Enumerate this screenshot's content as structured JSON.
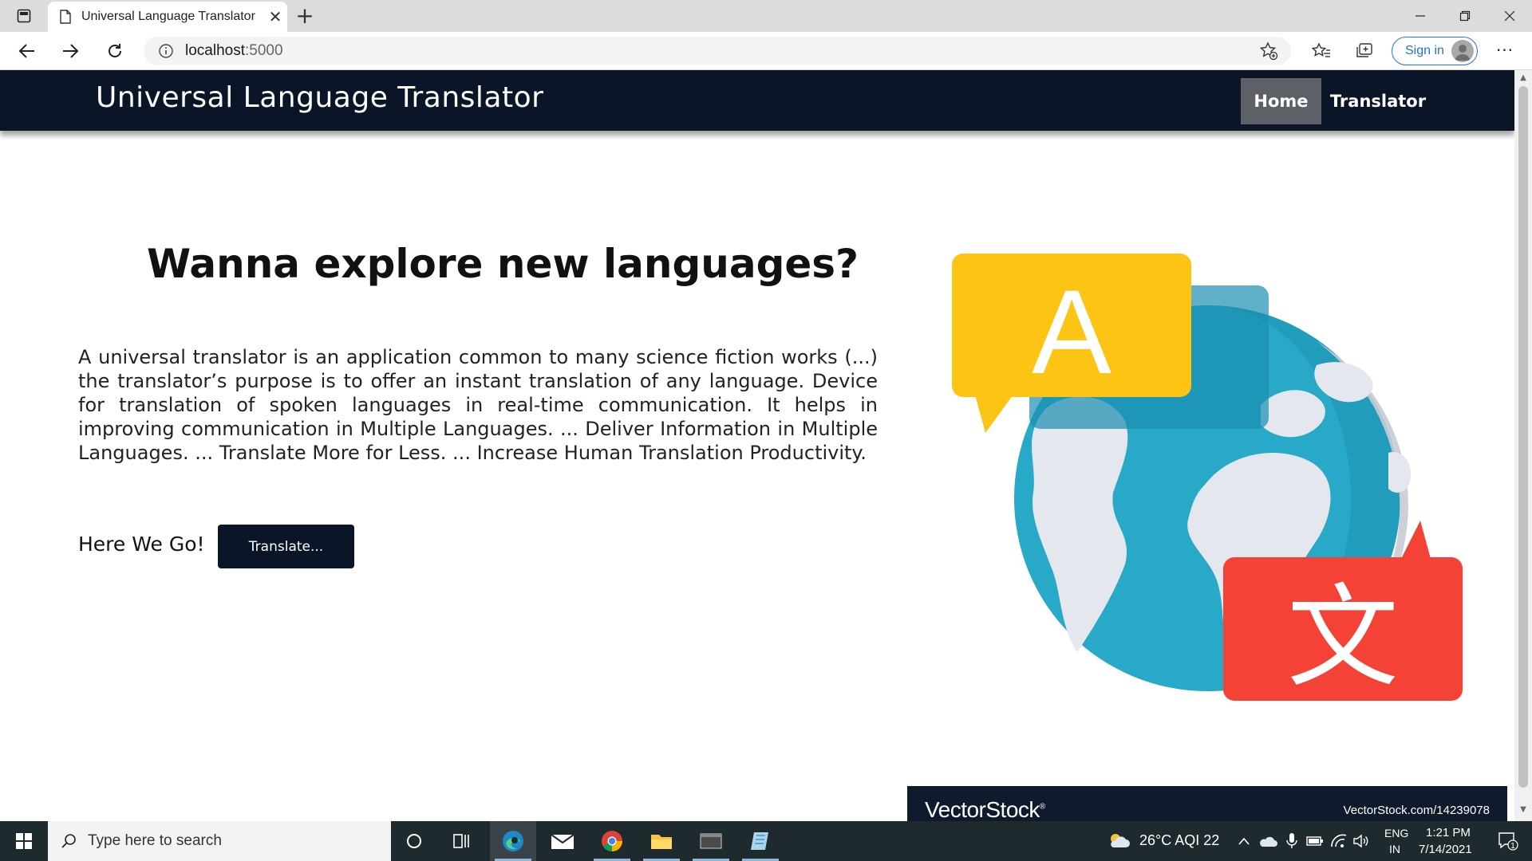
{
  "browser": {
    "tab_title": "Universal Language Translator",
    "tab_close": "✕",
    "new_tab": "+",
    "url_host": "localhost",
    "url_port": ":5000",
    "signin_label": "Sign in",
    "more_label": "···"
  },
  "navbar": {
    "brand": "Universal Language Translator",
    "home": "Home",
    "translator": "Translator"
  },
  "hero": {
    "title": "Wanna explore new languages?",
    "paragraph": "A universal translator is an application common to many science fiction works (...) the translator’s purpose is to offer an instant translation of any language. Device for translation of spoken languages in real-time communication. It helps in improving communication in Multiple Languages. ... Deliver Information in Multiple Languages. ... Translate More for Less. ... Increase Human Translation Productivity.",
    "cta_label": "Here We Go!",
    "cta_button": "Translate..."
  },
  "illustration": {
    "bubble_a_letter": "A",
    "bubble_b_glyph": "文",
    "vs_logo": "VectorStock",
    "vs_reg": "®",
    "vs_url": "VectorStock.com/14239078"
  },
  "taskbar": {
    "search_placeholder": "Type here to search",
    "weather": "26°C  AQI 22",
    "lang_top": "ENG",
    "lang_bottom": "IN",
    "time": "1:21 PM",
    "date": "7/14/2021",
    "notifications": "1"
  },
  "colors": {
    "navbar_bg": "#0a1628",
    "home_active_bg": "#5e6068",
    "bubble_yellow": "#fdc513",
    "bubble_red": "#f44336",
    "globe_blue": "#27a9c7"
  }
}
